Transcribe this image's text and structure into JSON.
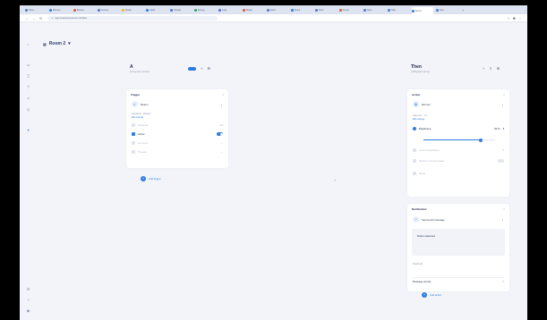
{
  "browser": {
    "tabs": [
      {
        "label": "Home",
        "color": "#4a7bd0"
      },
      {
        "label": "Devices",
        "color": "#2f7de1"
      },
      {
        "label": "Rooms",
        "color": "#e0593c"
      },
      {
        "label": "Scenes",
        "color": "#4a7bd0"
      },
      {
        "label": "Studio",
        "color": "#f0b429"
      },
      {
        "label": "Lights",
        "color": "#2f7de1"
      },
      {
        "label": "Climate",
        "color": "#4a7bd0"
      },
      {
        "label": "Energy",
        "color": "#36a36a"
      },
      {
        "label": "Logs",
        "color": "#4a7bd0"
      },
      {
        "label": "Media",
        "color": "#e0593c"
      },
      {
        "label": "Alarm",
        "color": "#4a7bd0"
      },
      {
        "label": "Setup",
        "color": "#2f7de1"
      },
      {
        "label": "Docs",
        "color": "#4a7bd0"
      },
      {
        "label": "Forum",
        "color": "#e0593c"
      },
      {
        "label": "Store",
        "color": "#4a7bd0"
      },
      {
        "label": "Help",
        "color": "#4a7bd0"
      },
      {
        "label": "Scene",
        "color": "#2f7de1",
        "active": true
      },
      {
        "label": "New",
        "color": "#4a7bd0"
      }
    ],
    "url": "app.local/scenes/room-2/editor"
  },
  "header": {
    "title": "Room 2",
    "chevron": "▾"
  },
  "left_device": {
    "name": "A",
    "subtitle": "Living room sensor",
    "card": {
      "title": "Trigger",
      "device_label": "Motion",
      "info": "Sensitivity · Medium",
      "info_link": "Edit settings",
      "rows": [
        {
          "label": "Presence",
          "value": "Off"
        },
        {
          "label": "Active",
          "value": "On",
          "on": true
        },
        {
          "label": "Lux level",
          "value": "—"
        },
        {
          "label": "Timeout",
          "value": "—"
        }
      ]
    },
    "add_label": "Add trigger"
  },
  "right_device": {
    "name": "Then",
    "subtitle": "Ceiling light group",
    "action_card": {
      "title": "Action",
      "device_label": "Dimmer",
      "info": "Fade time · 2 s",
      "info_link": "Edit settings",
      "brightness_label": "Brightness",
      "brightness_value": "80 %",
      "brightness_fraction": 0.8,
      "rows": [
        {
          "label": "Color temperature"
        },
        {
          "label": "Restore previous state"
        },
        {
          "label": "Delay"
        }
      ]
    },
    "notify_card": {
      "title": "Notification",
      "device_label": "Send push message",
      "message": "Motion detected",
      "field_label": "Recipients",
      "dropdown_label": "Message priority"
    },
    "add_label": "Add action"
  },
  "icons": {
    "rail": [
      "home-icon",
      "devices-icon",
      "rooms-icon",
      "automation-icon",
      "energy-icon",
      "scenes-icon"
    ],
    "rail_bottom": [
      "settings-icon",
      "help-icon",
      "profile-icon"
    ]
  },
  "colors": {
    "accent": "#2f7de1",
    "background": "#f3f4f9",
    "card": "#ffffff"
  }
}
